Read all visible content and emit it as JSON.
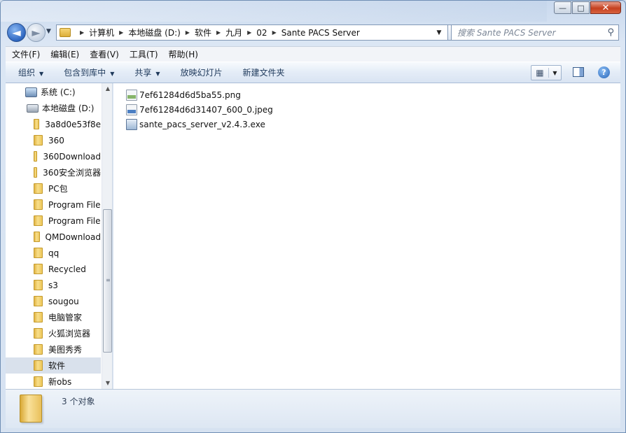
{
  "window": {
    "caption_buttons": {
      "minimize": "—",
      "maximize": "□",
      "close": "✕"
    }
  },
  "navigation": {
    "back_glyph": "◄",
    "forward_glyph": "►",
    "breadcrumb": [
      "计算机",
      "本地磁盘 (D:)",
      "软件",
      "九月",
      "02",
      "Sante PACS Server"
    ],
    "search_placeholder": "搜索 Sante PACS Server"
  },
  "menubar": [
    "文件(F)",
    "编辑(E)",
    "查看(V)",
    "工具(T)",
    "帮助(H)"
  ],
  "toolbar": {
    "organize": "组织",
    "include_in_library": "包含到库中",
    "share": "共享",
    "slideshow": "放映幻灯片",
    "new_folder": "新建文件夹"
  },
  "sidebar": {
    "items": [
      {
        "label": "系统 (C:)",
        "icon": "system-drive-icon"
      },
      {
        "label": "本地磁盘 (D:)",
        "icon": "drive-icon"
      },
      {
        "label": "3a8d0e53f8e",
        "icon": "folder-icon"
      },
      {
        "label": "360",
        "icon": "folder-icon"
      },
      {
        "label": "360Download",
        "icon": "folder-icon"
      },
      {
        "label": "360安全浏览器",
        "icon": "folder-icon"
      },
      {
        "label": "PC包",
        "icon": "folder-icon"
      },
      {
        "label": "Program File",
        "icon": "folder-icon"
      },
      {
        "label": "Program File",
        "icon": "folder-icon"
      },
      {
        "label": "QMDownload",
        "icon": "folder-icon"
      },
      {
        "label": "qq",
        "icon": "folder-icon"
      },
      {
        "label": "Recycled",
        "icon": "folder-icon"
      },
      {
        "label": "s3",
        "icon": "folder-icon"
      },
      {
        "label": "sougou",
        "icon": "folder-icon"
      },
      {
        "label": "电脑管家",
        "icon": "folder-icon"
      },
      {
        "label": "火狐浏览器",
        "icon": "folder-icon"
      },
      {
        "label": "美图秀秀",
        "icon": "folder-icon"
      },
      {
        "label": "软件",
        "icon": "folder-icon",
        "selected": true
      },
      {
        "label": "新obs",
        "icon": "folder-icon"
      }
    ]
  },
  "files": [
    {
      "name": "7ef61284d6d5ba55.png",
      "type": "png"
    },
    {
      "name": "7ef61284d6d31407_600_0.jpeg",
      "type": "jpg"
    },
    {
      "name": "sante_pacs_server_v2.4.3.exe",
      "type": "exe"
    }
  ],
  "details": {
    "item_count": "3 个对象"
  }
}
